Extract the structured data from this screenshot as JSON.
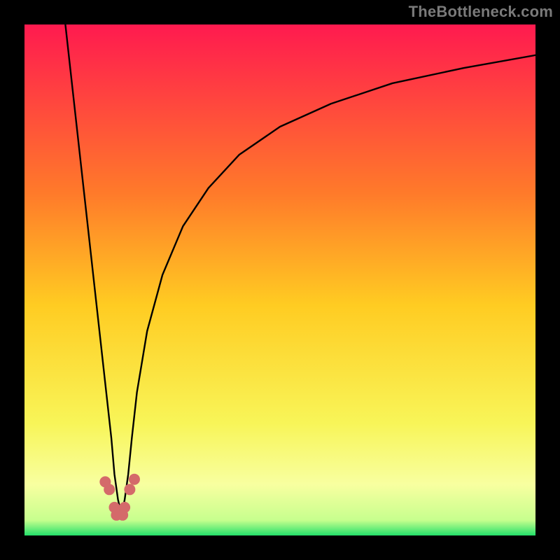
{
  "watermark": "TheBottleneck.com",
  "chart_data": {
    "type": "line",
    "title": "",
    "xlabel": "",
    "ylabel": "",
    "xlim": [
      0,
      100
    ],
    "ylim": [
      0,
      100
    ],
    "grid": false,
    "legend": "none",
    "gradient_stops": [
      {
        "pos": 0.0,
        "color": "#ff1a4f"
      },
      {
        "pos": 0.33,
        "color": "#ff7a2a"
      },
      {
        "pos": 0.55,
        "color": "#ffcc22"
      },
      {
        "pos": 0.78,
        "color": "#f8f558"
      },
      {
        "pos": 0.9,
        "color": "#f8ffa0"
      },
      {
        "pos": 0.97,
        "color": "#c7ff8e"
      },
      {
        "pos": 1.0,
        "color": "#23e06a"
      }
    ],
    "series": [
      {
        "name": "bottleneck-curve",
        "x": [
          8,
          9,
          10,
          11,
          12,
          13,
          14,
          15,
          16,
          17,
          17.6,
          18.3,
          19,
          19.6,
          20.3,
          21,
          22,
          24,
          27,
          31,
          36,
          42,
          50,
          60,
          72,
          86,
          100
        ],
        "y": [
          100,
          91,
          82,
          73,
          64,
          55,
          46,
          37,
          28,
          19,
          12,
          7,
          4,
          7,
          12,
          19,
          28,
          40,
          51,
          60.5,
          68,
          74.5,
          80,
          84.5,
          88.5,
          91.5,
          94
        ]
      }
    ],
    "markers": {
      "name": "highlight-dots",
      "color": "#d46a6a",
      "radius_px": 8,
      "points": [
        {
          "x": 15.8,
          "y": 10.5
        },
        {
          "x": 16.6,
          "y": 9.0
        },
        {
          "x": 17.6,
          "y": 5.5
        },
        {
          "x": 18.0,
          "y": 4.0
        },
        {
          "x": 19.2,
          "y": 4.0
        },
        {
          "x": 19.6,
          "y": 5.5
        },
        {
          "x": 20.6,
          "y": 9.0
        },
        {
          "x": 21.5,
          "y": 11.0
        }
      ]
    }
  }
}
